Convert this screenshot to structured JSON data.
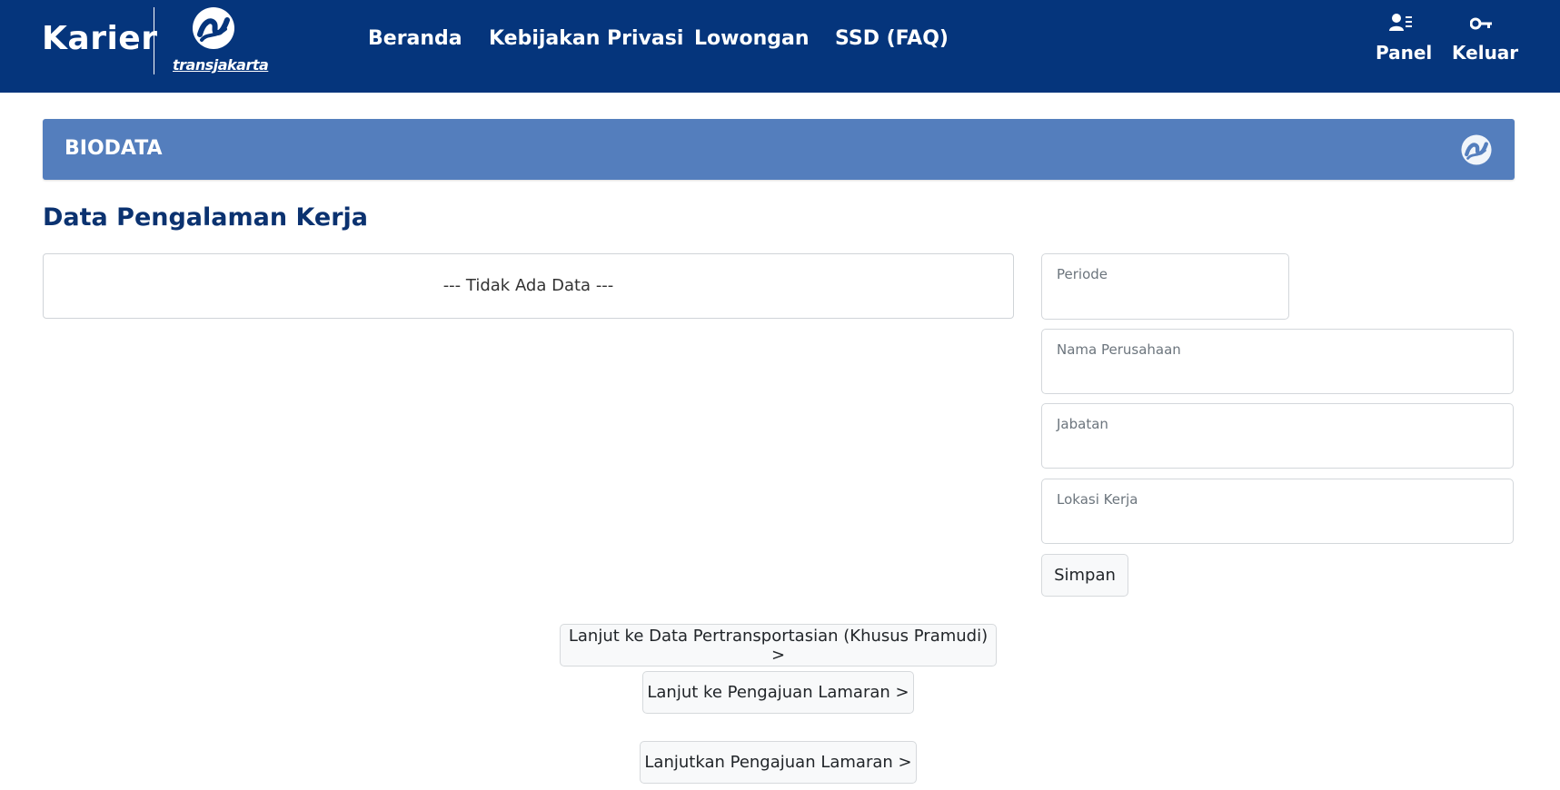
{
  "navbar": {
    "brand": "Karier",
    "logo_text": "transjakarta",
    "links": [
      "Beranda",
      "Kebijakan Privasi",
      "Lowongan",
      "SSD (FAQ)"
    ],
    "panel_label": "Panel",
    "logout_label": "Keluar"
  },
  "biodata": {
    "title": "BIODATA"
  },
  "section": {
    "title": "Data Pengalaman Kerja"
  },
  "table": {
    "empty_text": "--- Tidak Ada Data ---"
  },
  "form": {
    "periode": {
      "label": "Periode",
      "value": ""
    },
    "company": {
      "label": "Nama Perusahaan",
      "value": ""
    },
    "position": {
      "label": "Jabatan",
      "value": ""
    },
    "location": {
      "label": "Lokasi Kerja",
      "value": ""
    },
    "save_label": "Simpan"
  },
  "actions": {
    "transport_label": "Lanjut ke Data Pertransportasian (Khusus Pramudi) >",
    "apply_label": "Lanjut ke Pengajuan Lamaran >",
    "continue_label": "Lanjutkan Pengajuan Lamaran >"
  },
  "colors": {
    "navbar": "#05357c",
    "biodata_bar": "#547ebd",
    "section_title": "#0b3270"
  }
}
